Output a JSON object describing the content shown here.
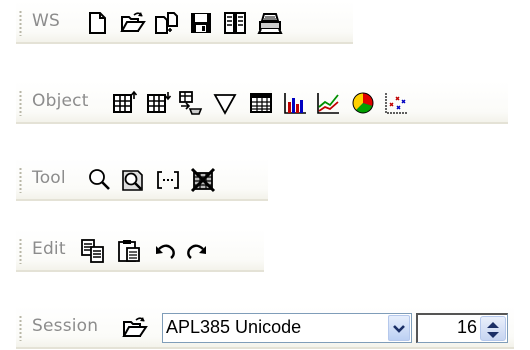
{
  "toolbars": {
    "ws": {
      "label": "WS",
      "icons": [
        "new-workspace-icon",
        "open-workspace-icon",
        "copy-workspace-icon",
        "save-workspace-icon",
        "explorer-icon",
        "print-icon"
      ]
    },
    "object": {
      "label": "Object",
      "icons": [
        "new-object-icon",
        "insert-object-icon",
        "edit-object-icon",
        "filter-icon",
        "grid-icon",
        "bar-chart-icon",
        "line-chart-icon",
        "pie-chart-icon",
        "scatter-chart-icon"
      ]
    },
    "tool": {
      "label": "Tool",
      "icons": [
        "search-icon",
        "find-replace-icon",
        "ellipsis-icon",
        "clear-icon"
      ]
    },
    "edit": {
      "label": "Edit",
      "icons": [
        "copy-icon",
        "paste-icon",
        "undo-icon",
        "redo-icon"
      ]
    },
    "session": {
      "label": "Session",
      "icons": [
        "load-font-icon"
      ],
      "font_select": {
        "value": "APL385 Unicode"
      },
      "size_spinner": {
        "value": "16"
      }
    }
  },
  "colors": {
    "toolbar_line": "#e4e2d6",
    "label_text": "#8c8c8c",
    "combo_border": "#7f9db9",
    "dropdown_button": "#bcd0f3"
  }
}
